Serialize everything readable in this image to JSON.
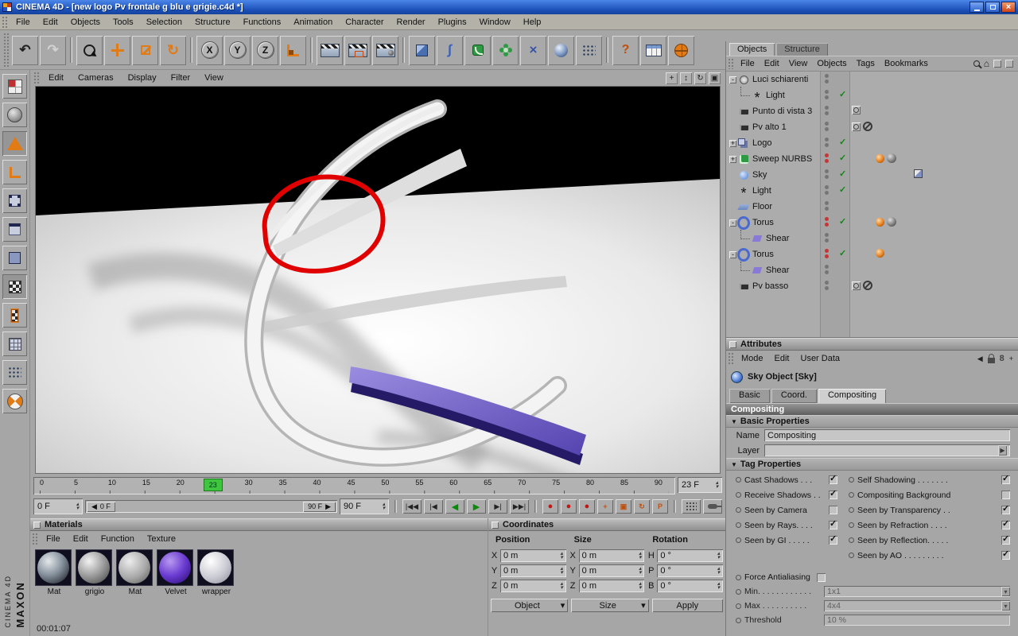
{
  "window": {
    "title": "CINEMA 4D - [new logo Pv frontale g blu e grigie.c4d *]"
  },
  "menubar": [
    "File",
    "Edit",
    "Objects",
    "Tools",
    "Selection",
    "Structure",
    "Functions",
    "Animation",
    "Character",
    "Render",
    "Plugins",
    "Window",
    "Help"
  ],
  "icons": {
    "undo": "↶",
    "redo": "↷",
    "help": "?",
    "axis_x": "X",
    "axis_y": "Y",
    "axis_z": "Z",
    "vp_pan": "+",
    "vp_zoom": "↕",
    "vp_rotate": "↻",
    "vp_toggle": "▣",
    "expand_plus": "+",
    "expand_minus": "-",
    "collapse_arrow": "▼",
    "dropdown_arrow": "▾",
    "spin_up": "▴",
    "spin_down": "▾",
    "left_arrow": "◀",
    "right_arrow": "▶",
    "home": "⌂",
    "link": "8",
    "spline": "∫",
    "deform": "×",
    "rec_pos": "+",
    "rec_scale": "▣",
    "rec_rot": "↻",
    "rec_param": "P"
  },
  "viewport": {
    "menus": [
      "Edit",
      "Cameras",
      "Display",
      "Filter",
      "View"
    ]
  },
  "object_manager": {
    "tabs": [
      "Objects",
      "Structure"
    ],
    "menus": [
      "File",
      "Edit",
      "View",
      "Objects",
      "Tags",
      "Bookmarks"
    ],
    "items": [
      {
        "label": "Luci schiarenti"
      },
      {
        "label": "Light"
      },
      {
        "label": "Punto di vista 3"
      },
      {
        "label": "Pv alto 1"
      },
      {
        "label": "Logo"
      },
      {
        "label": "Sweep NURBS"
      },
      {
        "label": "Sky"
      },
      {
        "label": "Light"
      },
      {
        "label": "Floor"
      },
      {
        "label": "Torus"
      },
      {
        "label": "Shear"
      },
      {
        "label": "Torus"
      },
      {
        "label": "Shear"
      },
      {
        "label": "Pv basso"
      }
    ]
  },
  "attributes": {
    "title": "Attributes",
    "menus": [
      "Mode",
      "Edit",
      "User Data"
    ],
    "object_title": "Sky Object [Sky]",
    "tabs": [
      "Basic",
      "Coord.",
      "Compositing"
    ],
    "section_title": "Compositing",
    "basic_properties": "Basic Properties",
    "name_label": "Name",
    "name_value": "Compositing",
    "layer_label": "Layer",
    "tag_properties": "Tag Properties",
    "checks_left": [
      {
        "label": "Cast Shadows . . .",
        "checked": true
      },
      {
        "label": "Receive Shadows . .",
        "checked": true
      },
      {
        "label": "Seen by Camera",
        "checked": false
      },
      {
        "label": "Seen by Rays. . . .",
        "checked": true
      },
      {
        "label": "Seen by GI . . . . .",
        "checked": true
      }
    ],
    "checks_right": [
      {
        "label": "Self Shadowing . . . . . . .",
        "checked": true
      },
      {
        "label": "Compositing Background",
        "checked": false
      },
      {
        "label": "Seen by Transparency . .",
        "checked": true
      },
      {
        "label": "Seen by Refraction . . . .",
        "checked": true
      },
      {
        "label": "Seen by Reflection. . . . .",
        "checked": true
      },
      {
        "label": "Seen by AO . . . . . . . . .",
        "checked": true
      }
    ],
    "force_antialiasing": {
      "label": "Force Antialiasing",
      "checked": false
    },
    "min_label": "Min. . . . . . . . . . . .",
    "min_value": "1x1",
    "max_label": "Max . . . . . . . . . .",
    "max_value": "4x4",
    "threshold_label": "Threshold",
    "threshold_value": "10 %"
  },
  "timeline": {
    "ticks": [
      "0",
      "5",
      "10",
      "15",
      "20",
      "25",
      "30",
      "35",
      "40",
      "45",
      "50",
      "55",
      "60",
      "65",
      "70",
      "75",
      "80",
      "85",
      "90"
    ],
    "marker": "23",
    "current_frame": "23 F",
    "range_start": "0 F",
    "slider_min": "0 F",
    "slider_max": "90 F",
    "range_end": "90 F",
    "transport": [
      "|◀◀",
      "|◀",
      "◀",
      "▶",
      "▶|",
      "▶▶|"
    ],
    "records": [
      "●",
      "●",
      "●"
    ]
  },
  "materials": {
    "title": "Materials",
    "menus": [
      "File",
      "Edit",
      "Function",
      "Texture"
    ],
    "items": [
      {
        "label": "Mat"
      },
      {
        "label": "grigio"
      },
      {
        "label": "Mat"
      },
      {
        "label": "Velvet"
      },
      {
        "label": "wrapper"
      }
    ]
  },
  "coordinates": {
    "title": "Coordinates",
    "columns": [
      "Position",
      "Size",
      "Rotation"
    ],
    "position": [
      {
        "axis": "X",
        "value": "0 m"
      },
      {
        "axis": "Y",
        "value": "0 m"
      },
      {
        "axis": "Z",
        "value": "0 m"
      }
    ],
    "size": [
      {
        "axis": "X",
        "value": "0 m"
      },
      {
        "axis": "Y",
        "value": "0 m"
      },
      {
        "axis": "Z",
        "value": "0 m"
      }
    ],
    "rotation": [
      {
        "axis": "H",
        "value": "0 °"
      },
      {
        "axis": "P",
        "value": "0 °"
      },
      {
        "axis": "B",
        "value": "0 °"
      }
    ],
    "object_dropdown": "Object",
    "size_dropdown": "Size",
    "apply_button": "Apply"
  },
  "status": {
    "time": "00:01:07",
    "brand_maxon": "MAXON",
    "brand_c4d": "CINEMA 4D"
  }
}
